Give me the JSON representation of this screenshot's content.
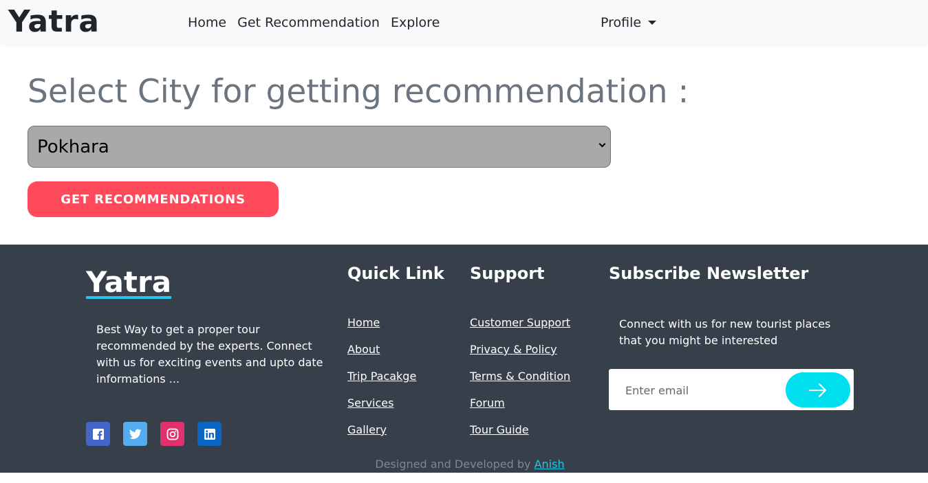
{
  "navbar": {
    "brand": "Yatra",
    "links": [
      "Home",
      "Get Recommendation",
      "Explore"
    ],
    "profile": "Profile"
  },
  "main": {
    "heading": "Select City for getting recommendation :",
    "city_select": {
      "selected": "Pokhara"
    },
    "recommend_button": "GET RECOMMENDATIONS"
  },
  "footer": {
    "brand": "Yatra",
    "description": "Best Way to get a proper tour recommended by the experts. Connect with us for exciting events and upto date informations ...",
    "socials": [
      {
        "icon": "facebook-icon",
        "color": "#4267c9"
      },
      {
        "icon": "twitter-icon",
        "color": "#55acee"
      },
      {
        "icon": "instagram-icon",
        "color": "#e1306c"
      },
      {
        "icon": "linkedin-icon",
        "color": "#0a66c2"
      }
    ],
    "quick_link": {
      "title": "Quick Link",
      "items": [
        "Home",
        "About",
        "Trip Pacakge",
        "Services",
        "Gallery"
      ]
    },
    "support": {
      "title": "Support",
      "items": [
        "Customer Support",
        "Privacy & Policy",
        "Terms & Condition",
        "Forum",
        "Tour Guide"
      ]
    },
    "newsletter": {
      "title": "Subscribe Newsletter",
      "description": "Connect with us for new tourist places that you might be interested",
      "placeholder": "Enter email"
    },
    "credit_prefix": "Designed and Developed by",
    "credit_author": "Anish"
  },
  "colors": {
    "accent_red": "#ff4a5c",
    "accent_cyan": "#00dff0",
    "footer_bg": "#363f4a"
  }
}
